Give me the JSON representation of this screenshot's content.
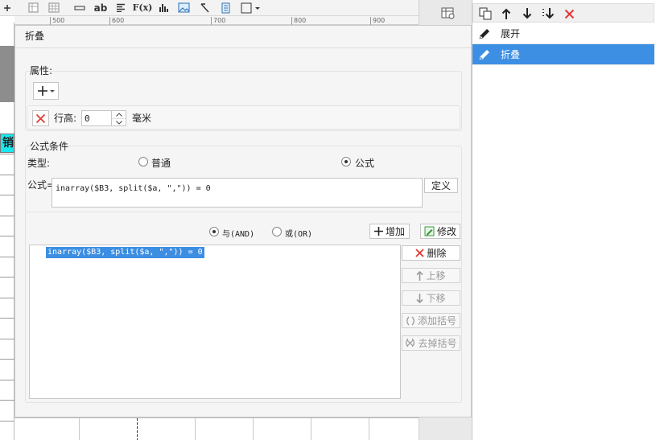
{
  "toolbar": {
    "icons": [
      "grid-icon",
      "table-icon",
      "line-icon",
      "text-icon",
      "align-icon",
      "formula-icon",
      "bar-chart-icon",
      "image-icon",
      "pointer-icon",
      "page-icon",
      "border-icon"
    ],
    "text_label": "ab",
    "formula_label": "F(x)"
  },
  "ruler": {
    "marks": [
      "500",
      "600",
      "700",
      "800",
      "900"
    ]
  },
  "sheet": {
    "cell_text": "销"
  },
  "dialog": {
    "title": "折叠",
    "attributes": {
      "legend": "属性:",
      "row_height_label": "行高:",
      "row_height_value": "0",
      "unit": "毫米"
    },
    "formula_condition": {
      "legend": "公式条件",
      "type_label": "类型:",
      "type_options": [
        "普通",
        "公式"
      ],
      "type_selected": "公式",
      "formula_label": "公式=",
      "formula_value": "inarray($B3, split($a, \",\")) = 0",
      "define_button": "定义",
      "logic_options": [
        "与(AND)",
        "或(OR)"
      ],
      "logic_selected": "与(AND)",
      "add_button": "增加",
      "modify_button": "修改",
      "conditions": [
        "inarray($B3, split($a, \",\")) = 0"
      ],
      "side_buttons": {
        "delete": "删除",
        "move_up": "上移",
        "move_down": "下移",
        "add_bracket": "添加括号",
        "remove_bracket": "去掉括号"
      }
    }
  },
  "panel": {
    "toolbar_icons": [
      "copy-icon",
      "arrow-up-icon",
      "arrow-down-icon",
      "move-bottom-icon",
      "delete-icon"
    ],
    "items": [
      {
        "label": "展开",
        "selected": false
      },
      {
        "label": "折叠",
        "selected": true
      }
    ]
  },
  "colors": {
    "selection": "#3d8fe4",
    "condition_highlight": "#3c8ee3",
    "delete_red": "#e53935",
    "cyan_cell": "#19e8ef"
  }
}
